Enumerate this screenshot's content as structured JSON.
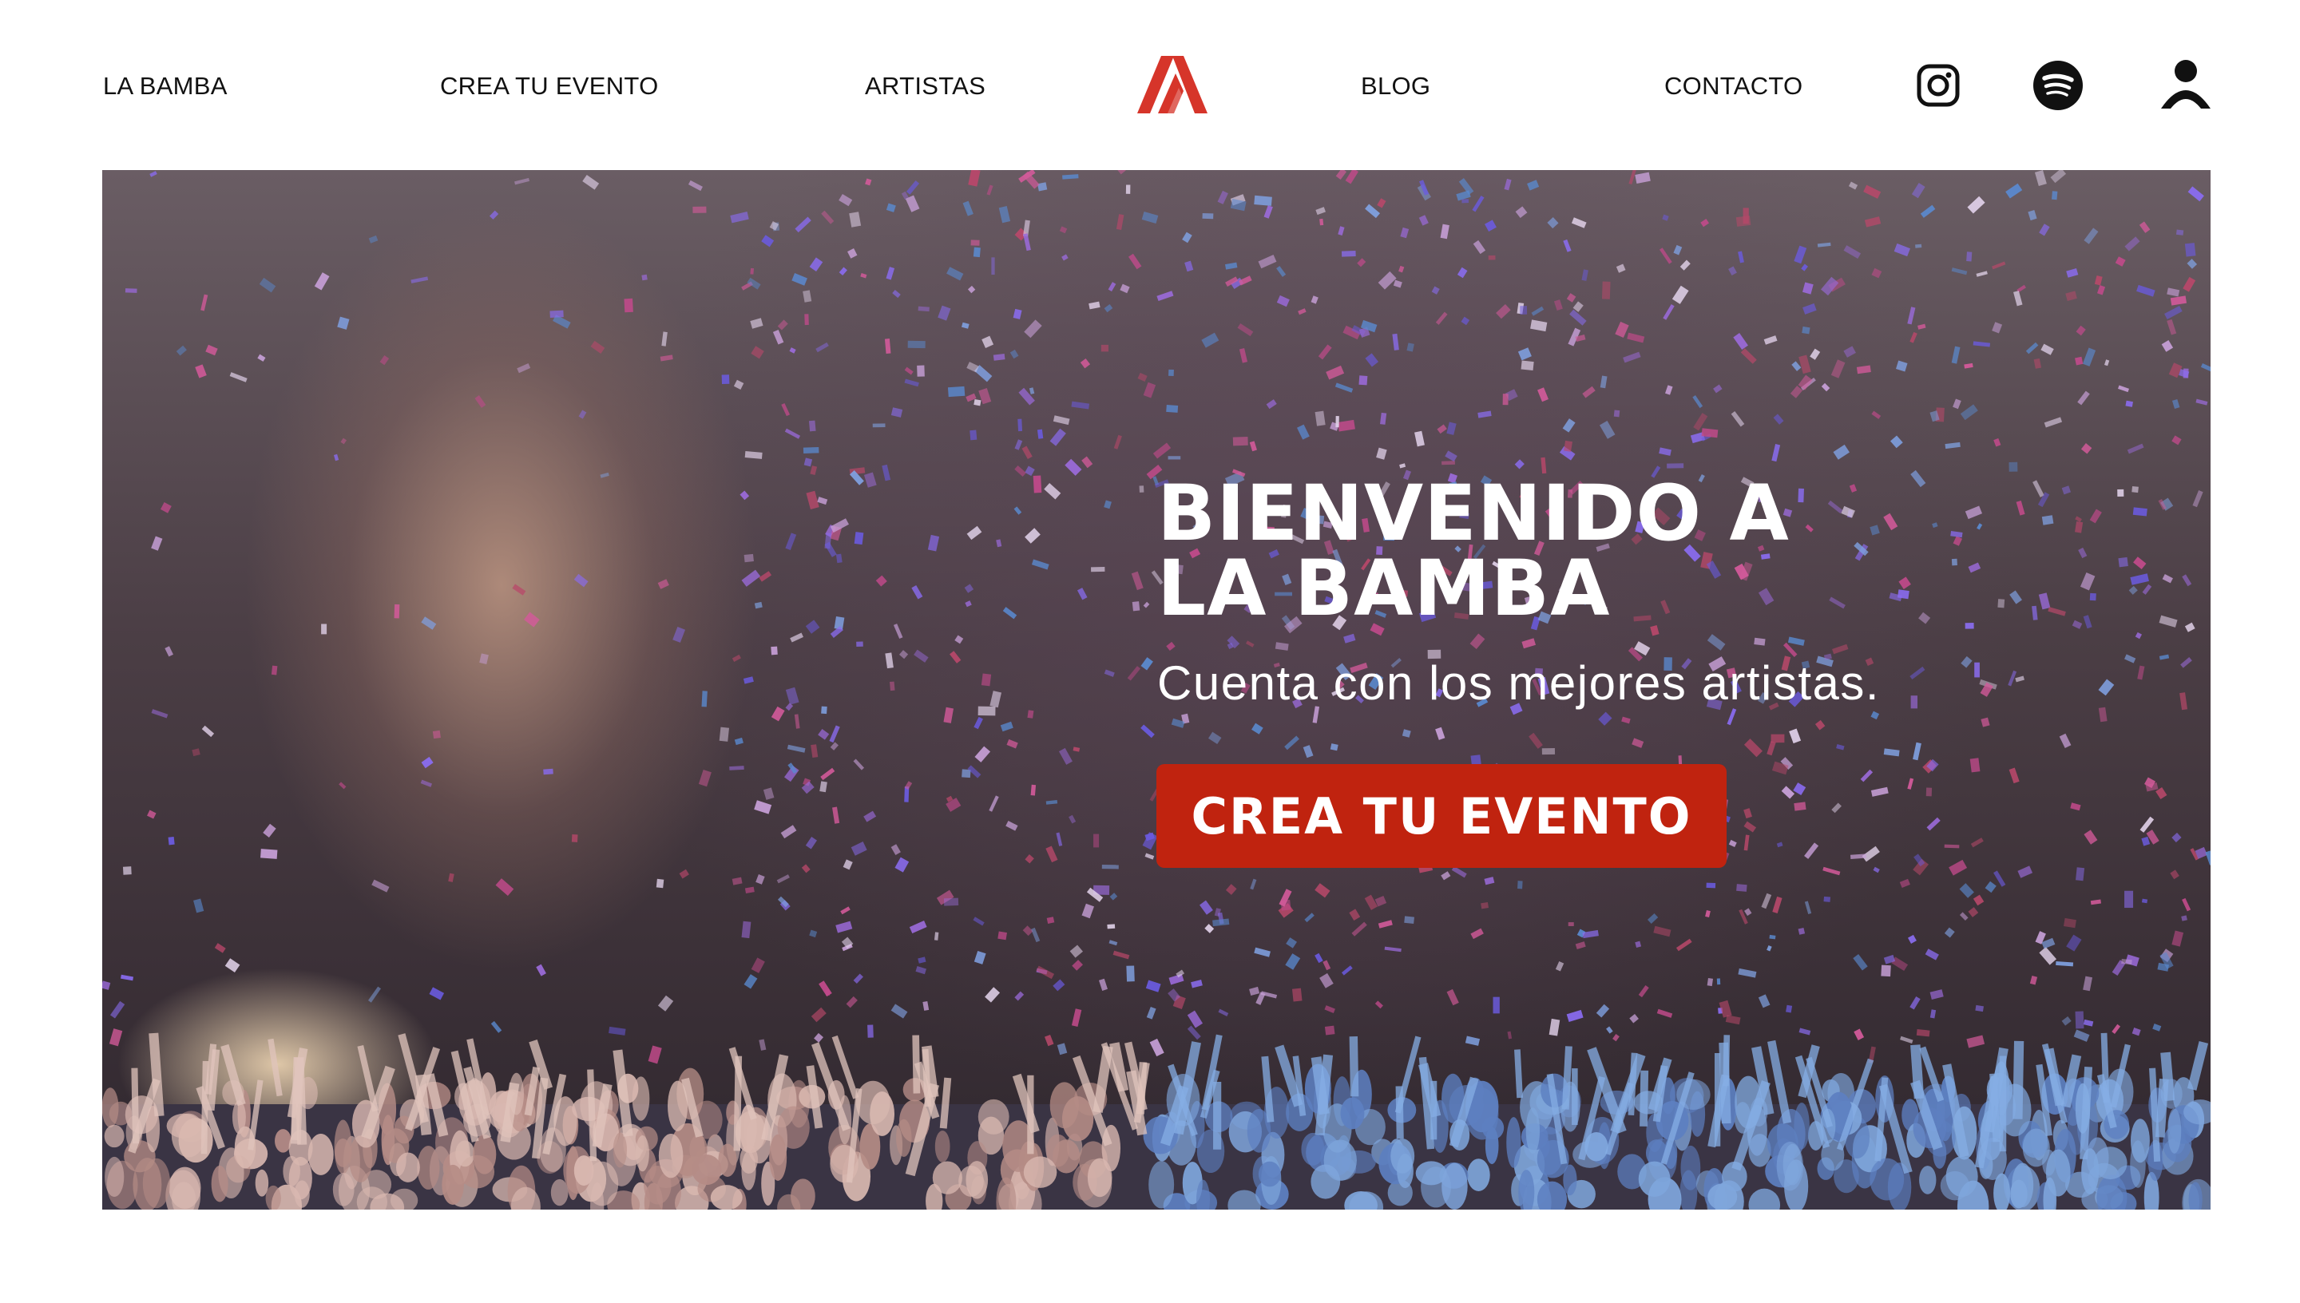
{
  "nav": {
    "items": [
      {
        "label": "LA BAMBA"
      },
      {
        "label": "CREA TU EVENTO"
      },
      {
        "label": "ARTISTAS"
      },
      {
        "label": "BLOG"
      },
      {
        "label": "CONTACTO"
      }
    ],
    "logo_icon": "la-bamba-logo-icon",
    "social_icons": [
      "instagram-icon",
      "spotify-icon",
      "user-account-icon"
    ]
  },
  "hero": {
    "title_line1": "BIENVENIDO A",
    "title_line2": "LA BAMBA",
    "subtitle": "Cuenta con los mejores artistas.",
    "cta_label": "CREA TU EVENTO"
  },
  "colors": {
    "accent": "#c0230f",
    "logo": "#d6352a",
    "text_dark": "#111111",
    "text_light": "#ffffff"
  }
}
